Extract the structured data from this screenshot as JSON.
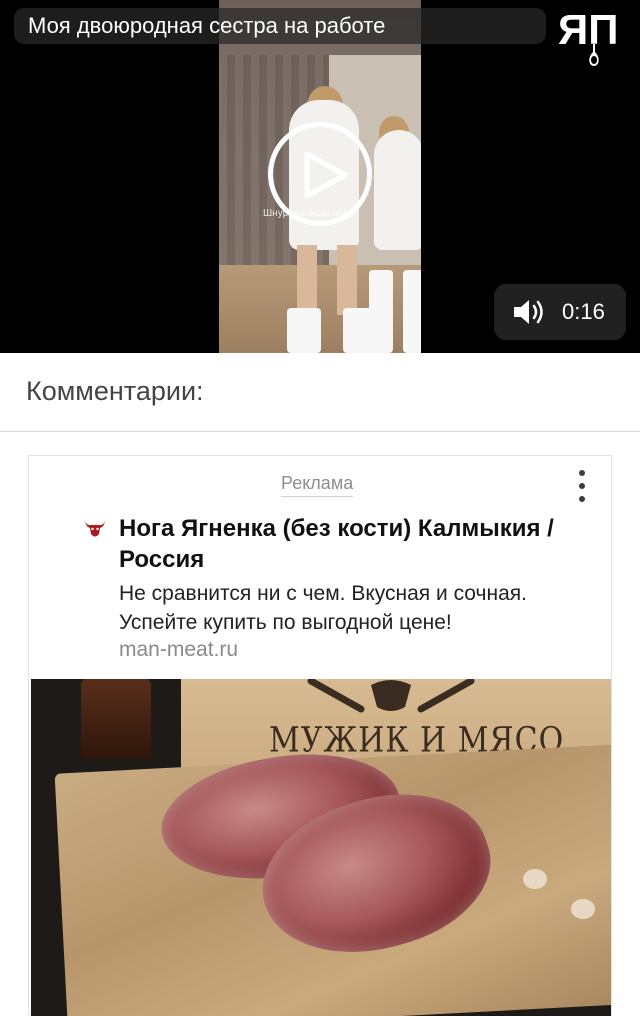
{
  "video": {
    "title": "Моя двоюродная сестра на работе",
    "logo_text": "ЯП",
    "overlay_text": "Шнур, напиши нам",
    "duration": "0:16",
    "icons": {
      "play": "play-icon",
      "volume": "volume-icon",
      "logo": "yap-logo"
    }
  },
  "comments": {
    "title": "Комментарии:"
  },
  "ad": {
    "label": "Реклама",
    "headline": "Нога Ягненка (без кости) Калмыкия / Россия",
    "text": "Не сравнится ни с чем. Вкусная и сочная. Успейте купить по выгодной цене!",
    "domain": "man-meat.ru",
    "image_sign_text": "МУЖИК И МЯСО",
    "icons": {
      "favicon": "bull-icon",
      "menu": "kebab-menu-icon"
    }
  },
  "colors": {
    "video_bg": "#000000",
    "pill_bg": "#282828",
    "divider": "#d6d6d6",
    "ad_label": "#8d8d8d",
    "headline": "#111111",
    "domain": "#8a8a8a"
  }
}
